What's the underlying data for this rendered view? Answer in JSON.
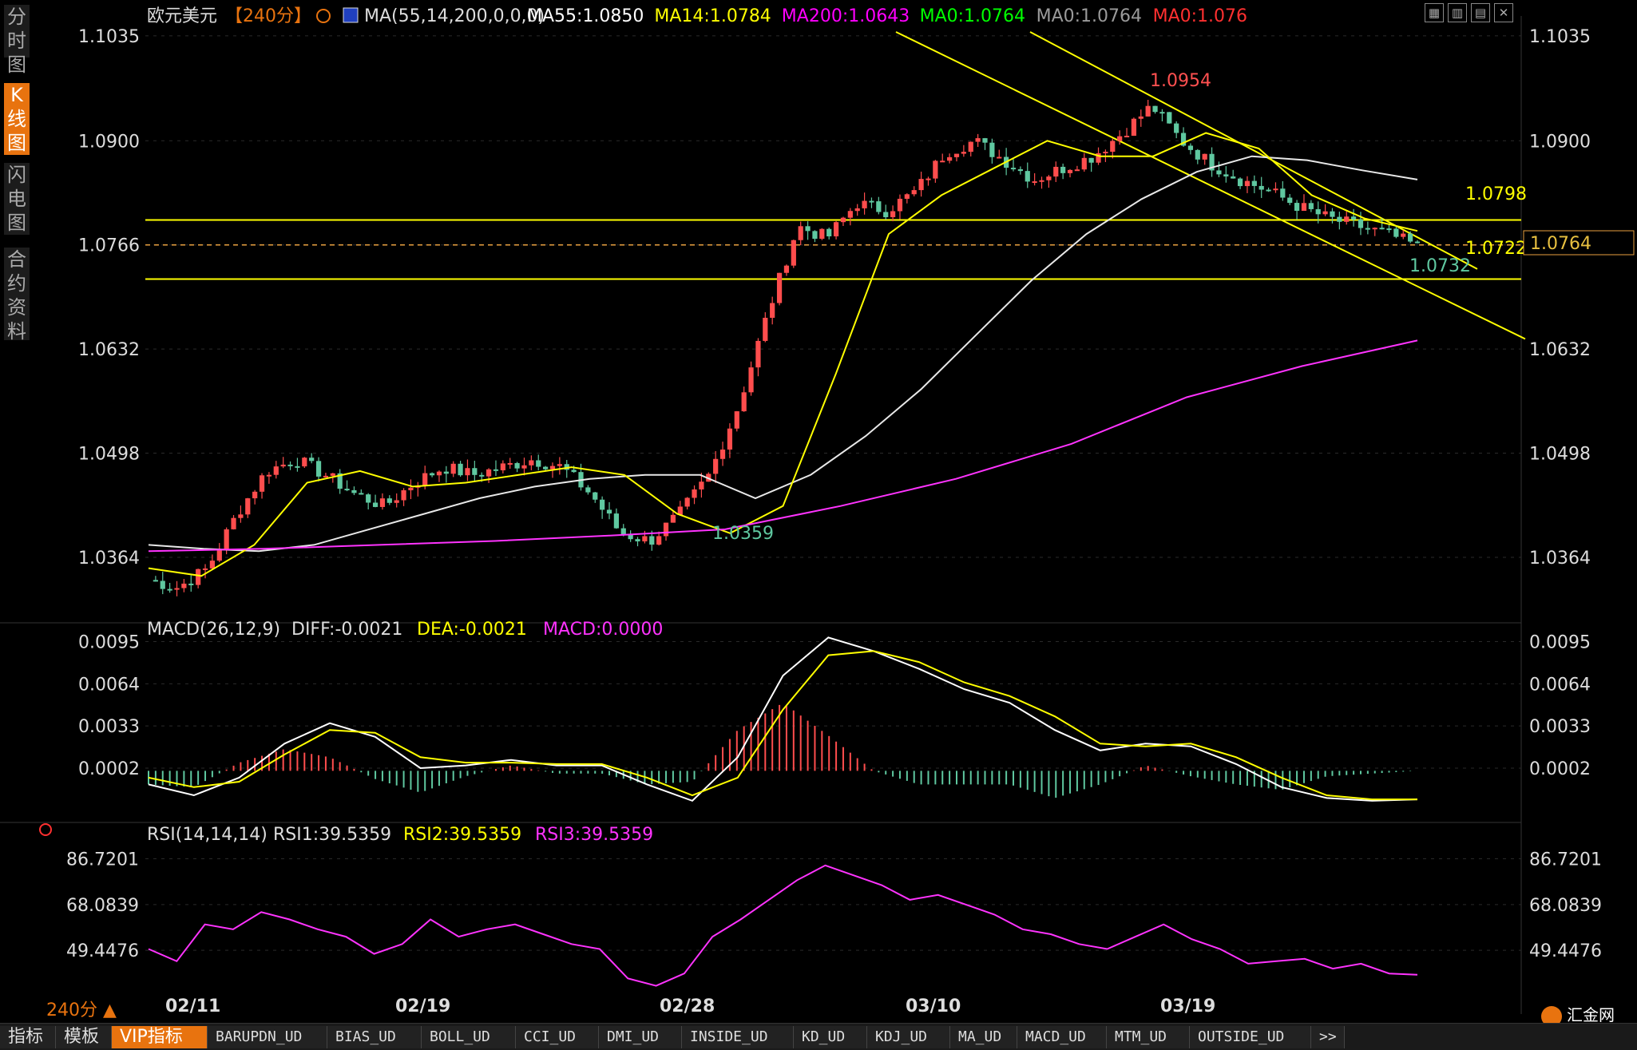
{
  "sidebar": {
    "tabs": [
      {
        "label": "分时图",
        "active": false
      },
      {
        "label": "K线图",
        "active": true
      },
      {
        "label": "闪电图",
        "active": false
      },
      {
        "label": "合约资料",
        "active": false
      }
    ]
  },
  "header": {
    "symbol": "欧元美元",
    "period": "【240分】",
    "ma_label": "MA(55,14,200,0,0,0)",
    "ma_items": [
      {
        "text": "MA55:1.0850",
        "color": "#ffffff"
      },
      {
        "text": "MA14:1.0784",
        "color": "#ffff00"
      },
      {
        "text": "MA200:1.0643",
        "color": "#ff00ff"
      },
      {
        "text": "MA0:1.0764",
        "color": "#00ff00"
      },
      {
        "text": "MA0:1.0764",
        "color": "#9a9a9a"
      },
      {
        "text": "MA0:1.076",
        "color": "#ff3030"
      }
    ]
  },
  "toolbar_icons": [
    "grid-icon",
    "layout-icon",
    "chart-icon",
    "close-icon"
  ],
  "price_panel": {
    "y_ticks": [
      "1.1035",
      "1.0900",
      "1.0766",
      "1.0632",
      "1.0498",
      "1.0364"
    ],
    "current_price": "1.0764",
    "labels": {
      "high": "1.0954",
      "low": "1.0359",
      "res": "1.0798",
      "sup": "1.0722",
      "last_low": "1.0732"
    }
  },
  "macd_panel": {
    "header": "MACD(26,12,9)",
    "diff": "DIFF:-0.0021",
    "dea": "DEA:-0.0021",
    "macd": "MACD:0.0000",
    "y_ticks": [
      "0.0095",
      "0.0064",
      "0.0033",
      "0.0002"
    ]
  },
  "rsi_panel": {
    "header": "RSI(14,14,14)",
    "rsi1": "RSI1:39.5359",
    "rsi2": "RSI2:39.5359",
    "rsi3": "RSI3:39.5359",
    "y_ticks": [
      "86.7201",
      "68.0839",
      "49.4476"
    ]
  },
  "x_ticks": [
    "02/11",
    "02/19",
    "02/28",
    "03/10",
    "03/19"
  ],
  "footer": {
    "period": "240分 ▲"
  },
  "bottom_tabs": [
    "指标",
    "模板",
    "VIP指标",
    "BARUPDN_UD",
    "BIAS_UD",
    "BOLL_UD",
    "CCI_UD",
    "DMI_UD",
    "INSIDE_UD",
    "KD_UD",
    "KDJ_UD",
    "MA_UD",
    "MACD_UD",
    "MTM_UD",
    "OUTSIDE_UD",
    ">>"
  ],
  "watermark": "汇金网",
  "colors": {
    "up": "#ff4d4d",
    "down": "#5fc8a0",
    "ma55": "#e8e8e8",
    "ma14": "#ffff00",
    "ma200": "#ff33ff",
    "level": "#ffff00",
    "dash": "#e8a040"
  },
  "chart_data": [
    {
      "type": "candlestick",
      "title": "欧元美元 240分",
      "x": [
        "02/11",
        "02/19",
        "02/28",
        "03/10",
        "03/19"
      ],
      "ylim": [
        1.029,
        1.104
      ],
      "y_ticks": [
        1.1035,
        1.09,
        1.0766,
        1.0632,
        1.0498,
        1.0364
      ],
      "close_path": [
        1.0335,
        1.0325,
        1.035,
        1.042,
        1.0475,
        1.049,
        1.047,
        1.0445,
        1.043,
        1.046,
        1.048,
        1.047,
        1.048,
        1.049,
        1.048,
        1.0445,
        1.0395,
        1.0385,
        1.042,
        1.047,
        1.056,
        1.068,
        1.079,
        1.0775,
        1.082,
        1.081,
        1.0835,
        1.0885,
        1.09,
        1.0875,
        1.085,
        1.0865,
        1.088,
        1.091,
        1.0945,
        1.09,
        1.087,
        1.085,
        1.0835,
        1.0815,
        1.08,
        1.079,
        1.078,
        1.0764
      ],
      "series": [
        {
          "name": "MA55",
          "values": [
            1.038,
            1.0375,
            1.0372,
            1.038,
            1.04,
            1.042,
            1.044,
            1.0455,
            1.0465,
            1.047,
            1.047,
            1.044,
            1.047,
            1.052,
            1.058,
            1.065,
            1.072,
            1.078,
            1.0825,
            1.086,
            1.088,
            1.0875,
            1.0862,
            1.085
          ]
        },
        {
          "name": "MA14",
          "values": [
            1.035,
            1.034,
            1.038,
            1.046,
            1.0475,
            1.0455,
            1.046,
            1.047,
            1.048,
            1.047,
            1.042,
            1.0395,
            1.043,
            1.06,
            1.078,
            1.083,
            1.0865,
            1.09,
            1.088,
            1.088,
            1.091,
            1.089,
            1.083,
            1.08,
            1.0784
          ]
        },
        {
          "name": "MA200",
          "values": [
            1.0372,
            1.0375,
            1.038,
            1.0385,
            1.0392,
            1.04,
            1.043,
            1.0465,
            1.051,
            1.057,
            1.061,
            1.0643
          ]
        }
      ],
      "levels": [
        1.0798,
        1.0722,
        1.0766
      ],
      "annotations": [
        {
          "text": "1.0954",
          "x": "03/18"
        },
        {
          "text": "1.0359",
          "x": "02/28"
        },
        {
          "text": "1.0732",
          "x": "03/24"
        }
      ],
      "current": 1.0764
    },
    {
      "type": "line",
      "title": "MACD(26,12,9)",
      "ylim": [
        -0.0035,
        0.01
      ],
      "y_ticks": [
        0.0095,
        0.0064,
        0.0033,
        0.0002
      ],
      "series": [
        {
          "name": "DIFF",
          "values": [
            -0.001,
            -0.0018,
            -0.0005,
            0.002,
            0.0035,
            0.0025,
            0.0002,
            0.0004,
            0.0008,
            0.0004,
            0.0004,
            -0.001,
            -0.0022,
            0.001,
            0.007,
            0.0098,
            0.0088,
            0.0075,
            0.006,
            0.005,
            0.003,
            0.0015,
            0.002,
            0.0018,
            0.0005,
            -0.0012,
            -0.002,
            -0.0022,
            -0.0021
          ]
        },
        {
          "name": "DEA",
          "values": [
            -0.0005,
            -0.0012,
            -0.0008,
            0.0012,
            0.003,
            0.0028,
            0.001,
            0.0006,
            0.0006,
            0.0005,
            0.0005,
            -0.0005,
            -0.0018,
            -0.0005,
            0.0045,
            0.0085,
            0.0088,
            0.008,
            0.0065,
            0.0055,
            0.004,
            0.002,
            0.0018,
            0.002,
            0.001,
            -0.0005,
            -0.0018,
            -0.0021,
            -0.0021
          ]
        },
        {
          "name": "MACD",
          "values": [
            -0.001,
            -0.0012,
            0.0006,
            0.0016,
            0.001,
            -0.0006,
            -0.0016,
            -0.0004,
            0.0004,
            -0.0002,
            -0.0002,
            -0.001,
            -0.0008,
            0.003,
            0.005,
            0.0026,
            0.0,
            -0.001,
            -0.001,
            -0.001,
            -0.002,
            -0.001,
            0.0004,
            -0.0004,
            -0.001,
            -0.0014,
            -0.0004,
            -0.0002,
            0.0
          ]
        }
      ]
    },
    {
      "type": "line",
      "title": "RSI(14,14,14)",
      "ylim": [
        30,
        95
      ],
      "y_ticks": [
        86.7201,
        68.0839,
        49.4476
      ],
      "series": [
        {
          "name": "RSI",
          "values": [
            50,
            45,
            60,
            58,
            65,
            62,
            58,
            55,
            48,
            52,
            62,
            55,
            58,
            60,
            56,
            52,
            50,
            38,
            35,
            40,
            55,
            62,
            70,
            78,
            84,
            80,
            76,
            70,
            72,
            68,
            64,
            58,
            56,
            52,
            50,
            55,
            60,
            54,
            50,
            44,
            45,
            46,
            42,
            44,
            40,
            39.5
          ]
        }
      ]
    }
  ]
}
